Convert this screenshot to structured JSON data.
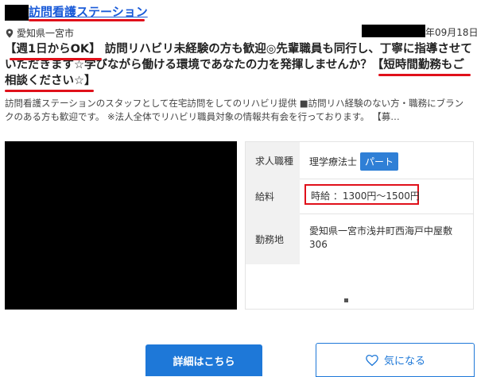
{
  "header": {
    "company_name": "訪問看護ステーション",
    "location": "愛知県一宮市",
    "date_suffix": "年09月18日"
  },
  "headline": {
    "highlight_1": "週1日からOK",
    "bracket_open": "【",
    "bracket_close": "】",
    "part_2": "訪問リハビリ未経験の方も歓迎◎先輩職員も同行し、丁寧に指導させていただきます☆学びながら働ける環境であなたの力を発揮しませんか？",
    "highlight_2": "【短時間勤務もご相談ください☆】"
  },
  "description": "訪問看護ステーションのスタッフとして在宅訪問をしてのリハビリ提供 ■訪問リハ経験のない方・職務にブランクのある方も歓迎です。 ※法人全体でリハビリ職員対象の情報共有会を行っております。 【募…",
  "info": {
    "job_type_label": "求人職種",
    "job_type_value": "理学療法士",
    "employment_badge": "パート",
    "salary_label": "給料",
    "salary_value": "時給 ：1300円～1500円",
    "location_label": "勤務地",
    "location_value": "愛知県一宮市浅井町西海戸中屋敷306"
  },
  "buttons": {
    "details": "詳細はこちら",
    "favorite": "気になる"
  },
  "colors": {
    "link": "#1a5bd8",
    "accent_red": "#e0101a",
    "primary_blue": "#1e78d8"
  },
  "icons": {
    "location": "map-pin-icon",
    "favorite": "heart-icon"
  }
}
